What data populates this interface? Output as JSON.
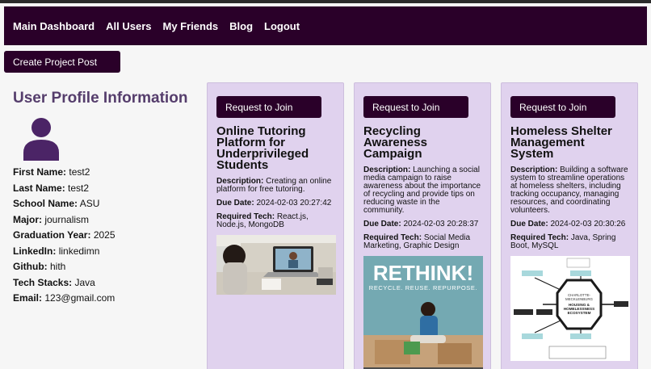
{
  "nav": {
    "items": [
      "Main Dashboard",
      "All Users",
      "My Friends",
      "Blog",
      "Logout"
    ]
  },
  "create_button": "Create Project Post",
  "profile": {
    "title": "User Profile Information",
    "fields": [
      {
        "label": "First Name:",
        "value": "test2"
      },
      {
        "label": "Last Name:",
        "value": "test2"
      },
      {
        "label": "School Name:",
        "value": "ASU"
      },
      {
        "label": "Major:",
        "value": "journalism"
      },
      {
        "label": "Graduation Year:",
        "value": "2025"
      },
      {
        "label": "LinkedIn:",
        "value": "linkedimn"
      },
      {
        "label": "Github:",
        "value": "hith"
      },
      {
        "label": "Tech Stacks:",
        "value": "Java"
      },
      {
        "label": "Email:",
        "value": "123@gmail.com"
      }
    ]
  },
  "projects": [
    {
      "join_label": "Request to Join",
      "title": "Online Tutoring Platform for Underprivileged Students",
      "desc_label": "Description:",
      "description": "Creating an online platform for free tutoring.",
      "due_label": "Due Date:",
      "due": "2024-02-03 20:27:42",
      "tech_label": "Required Tech:",
      "tech": "React.js, Node.js, MongoDB"
    },
    {
      "join_label": "Request to Join",
      "title": "Recycling Awareness Campaign",
      "desc_label": "Description:",
      "description": "Launching a social media campaign to raise awareness about the importance of recycling and provide tips on reducing waste in the community.",
      "due_label": "Due Date:",
      "due": "2024-02-03 20:28:37",
      "tech_label": "Required Tech:",
      "tech": "Social Media Marketing, Graphic Design",
      "poster_headline": "RETHINK!",
      "poster_sub": "RECYCLE. REUSE. REPURPOSE."
    },
    {
      "join_label": "Request to Join",
      "title": "Homeless Shelter Management System",
      "desc_label": "Description:",
      "description": "Building a software system to streamline operations at homeless shelters, including tracking occupancy, managing resources, and coordinating volunteers.",
      "due_label": "Due Date:",
      "due": "2024-02-03 20:30:26",
      "tech_label": "Required Tech:",
      "tech": "Java, Spring Boot, MySQL",
      "diagram_center": [
        "CHARLOTTE-",
        "MECKLENBURG",
        "HOUSING &",
        "HOMELESSNESS",
        "ECOSYSTEM"
      ]
    }
  ]
}
